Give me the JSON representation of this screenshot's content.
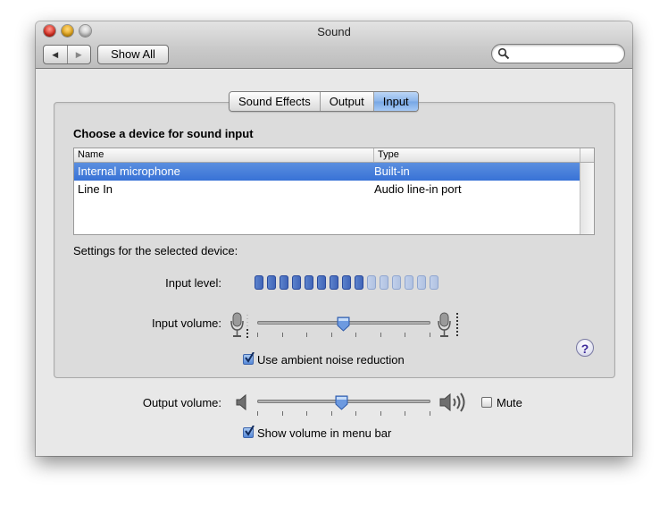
{
  "window": {
    "title": "Sound"
  },
  "toolbar": {
    "back_glyph": "◀",
    "forward_glyph": "▶",
    "show_all_label": "Show All",
    "search_value": "",
    "search_placeholder": ""
  },
  "tabs": [
    {
      "label": "Sound Effects",
      "active": false
    },
    {
      "label": "Output",
      "active": false
    },
    {
      "label": "Input",
      "active": true
    }
  ],
  "input_panel": {
    "section_title": "Choose a device for sound input",
    "table": {
      "columns": [
        "Name",
        "Type"
      ],
      "rows": [
        {
          "name": "Internal microphone",
          "type": "Built-in",
          "selected": true
        },
        {
          "name": "Line In",
          "type": "Audio line-in port",
          "selected": false
        }
      ]
    },
    "settings_label": "Settings for the selected device:",
    "input_level": {
      "label": "Input level:",
      "segments_total": 15,
      "segments_lit": 9
    },
    "input_volume": {
      "label": "Input volume:",
      "value_fraction": 0.5,
      "ticks": 8
    },
    "ambient_noise": {
      "label": "Use ambient noise reduction",
      "checked": true
    },
    "help_glyph": "?"
  },
  "output": {
    "volume": {
      "label": "Output volume:",
      "value_fraction": 0.49,
      "ticks": 8
    },
    "mute": {
      "label": "Mute",
      "checked": false
    },
    "menu_bar": {
      "label": "Show volume in menu bar",
      "checked": true
    }
  },
  "colors": {
    "selection": "#3872d6",
    "meter_on": "#3e62b6",
    "meter_off": "#aebfe0",
    "checkbox_checked": "#5588d8"
  },
  "icons": {
    "search": "magnifier-icon",
    "mic_low": "microphone-icon",
    "mic_high": "microphone-high-icon",
    "speaker_low": "speaker-low-icon",
    "speaker_high": "speaker-high-icon",
    "help": "help-icon"
  }
}
